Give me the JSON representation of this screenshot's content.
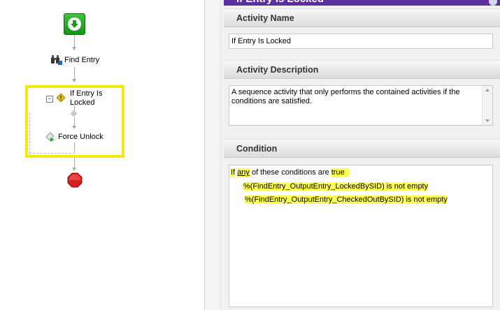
{
  "canvas": {
    "find_entry_label": "Find Entry",
    "condition_label": "If Entry Is Locked",
    "force_unlock_label": "Force Unlock",
    "collapse_symbol": "⊟"
  },
  "panel": {
    "title": "If Entry Is Locked",
    "activity_name_header": "Activity Name",
    "activity_name_value": "If Entry Is Locked",
    "activity_description_header": "Activity Description",
    "activity_description_value": "A sequence activity that only performs the contained activities if the conditions are satisfied.",
    "condition_header": "Condition",
    "condition": {
      "prefix": "If",
      "quantifier": "any",
      "middle": "of these conditions are",
      "value": "true",
      "lines": [
        "%(FindEntry_OutputEntry_LockedBySID) is not empty",
        "%(FindEntry_OutputEntry_CheckedOutBySID) is not empty"
      ]
    }
  },
  "colors": {
    "highlight_frame": "#f2e80a",
    "title_bar": "#5b2fa0",
    "start_green": "#1fa81f",
    "stop_red": "#d62020"
  }
}
